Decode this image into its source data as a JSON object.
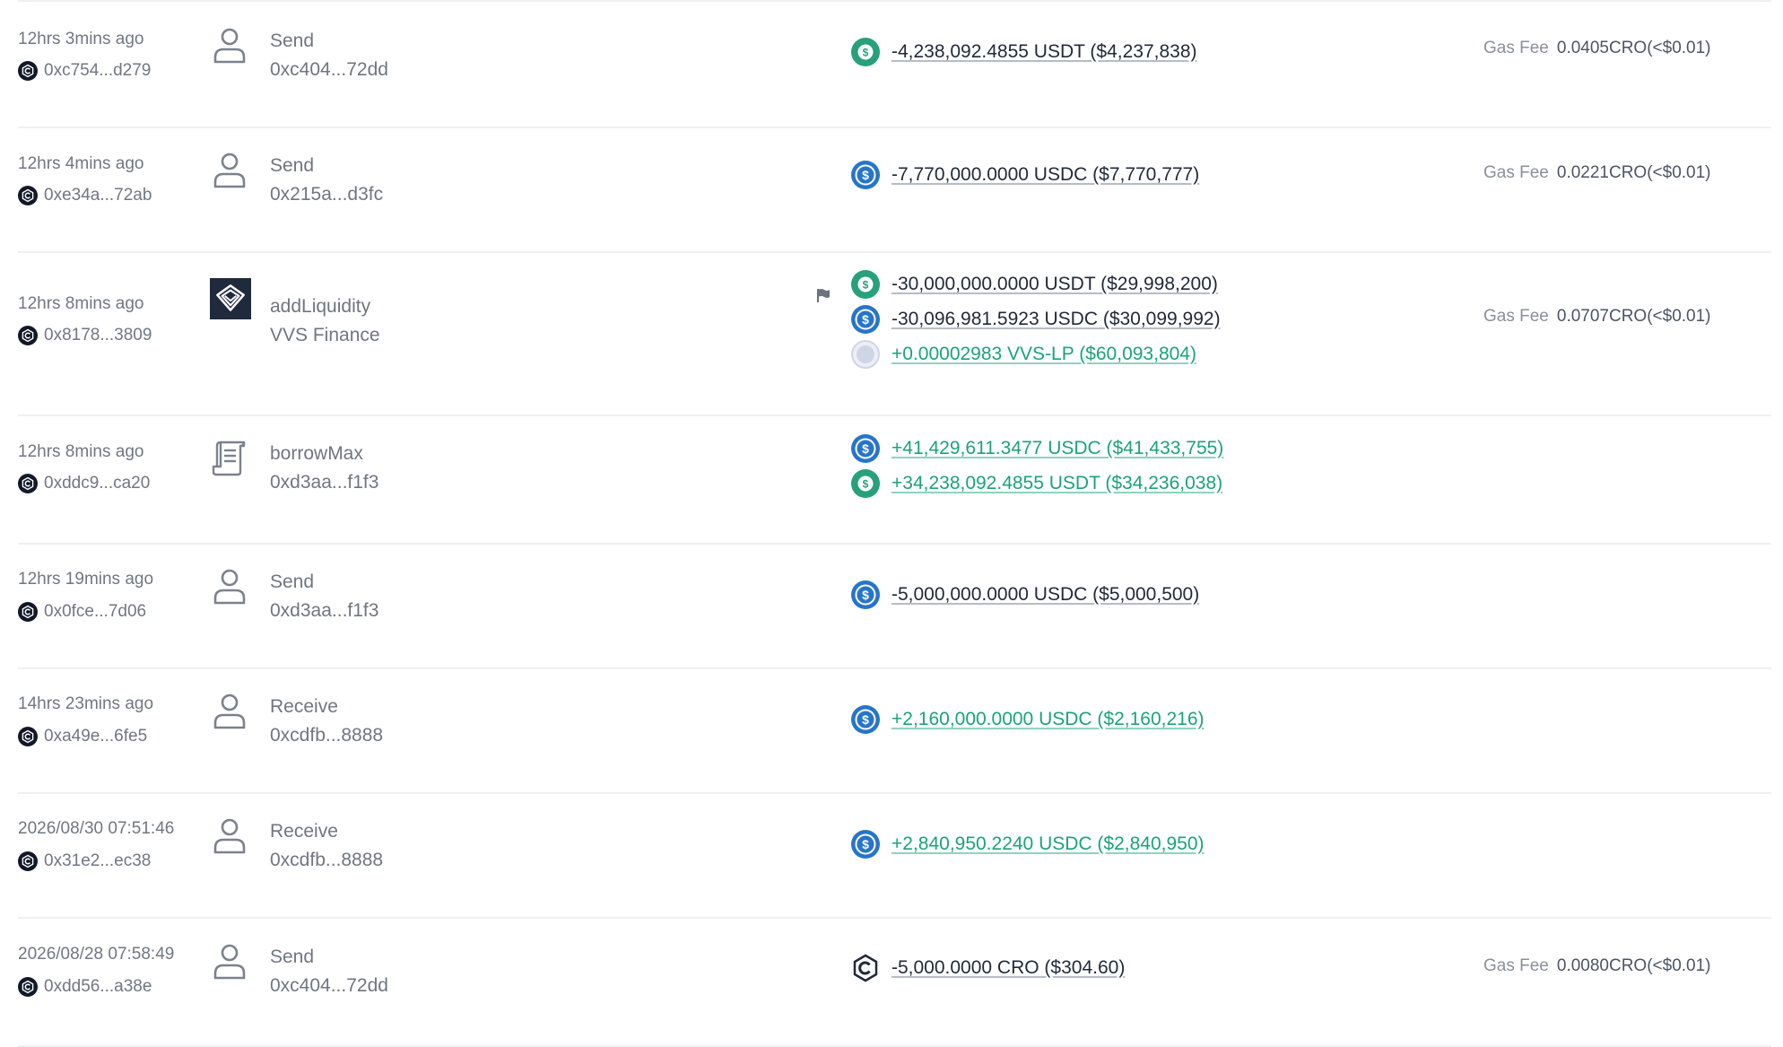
{
  "colors": {
    "usdt": "#26a17b",
    "usdc": "#2775ca",
    "lp": "#d0d5e6",
    "positive": "#1aa37a",
    "negative": "#1f2937",
    "divider": "#eef0f3"
  },
  "rows": [
    {
      "time": "12hrs 3mins ago",
      "hash": "0xc754...d279",
      "action": "Send",
      "address": "0xc404...72dd",
      "action_icon": "user-icon",
      "flag": false,
      "transfers": [
        {
          "icon": "usdt-icon",
          "text": "-4,238,092.4855 USDT ($4,237,838)",
          "sign": "neg"
        }
      ],
      "gas_label": "Gas Fee",
      "gas_value": "0.0405CRO(<$0.01)"
    },
    {
      "time": "12hrs 4mins ago",
      "hash": "0xe34a...72ab",
      "action": "Send",
      "address": "0x215a...d3fc",
      "action_icon": "user-icon",
      "flag": false,
      "transfers": [
        {
          "icon": "usdc-icon",
          "text": "-7,770,000.0000 USDC ($7,770,777)",
          "sign": "neg"
        }
      ],
      "gas_label": "Gas Fee",
      "gas_value": "0.0221CRO(<$0.01)"
    },
    {
      "time": "12hrs 8mins ago",
      "hash": "0x8178...3809",
      "action": "addLiquidity",
      "address": "VVS Finance",
      "action_icon": "vvs-finance-logo-icon",
      "flag": true,
      "transfers": [
        {
          "icon": "usdt-icon",
          "text": "-30,000,000.0000 USDT ($29,998,200)",
          "sign": "neg"
        },
        {
          "icon": "usdc-icon",
          "text": "-30,096,981.5923 USDC ($30,099,992)",
          "sign": "neg"
        },
        {
          "icon": "vvs-lp-icon",
          "text": "+0.00002983 VVS-LP ($60,093,804)",
          "sign": "pos"
        }
      ],
      "gas_label": "Gas Fee",
      "gas_value": "0.0707CRO(<$0.01)"
    },
    {
      "time": "12hrs 8mins ago",
      "hash": "0xddc9...ca20",
      "action": "borrowMax",
      "address": "0xd3aa...f1f3",
      "action_icon": "contract-scroll-icon",
      "flag": false,
      "transfers": [
        {
          "icon": "usdc-icon",
          "text": "+41,429,611.3477 USDC ($41,433,755)",
          "sign": "pos"
        },
        {
          "icon": "usdt-icon",
          "text": "+34,238,092.4855 USDT ($34,236,038)",
          "sign": "pos"
        }
      ],
      "gas_label": "",
      "gas_value": ""
    },
    {
      "time": "12hrs 19mins ago",
      "hash": "0x0fce...7d06",
      "action": "Send",
      "address": "0xd3aa...f1f3",
      "action_icon": "user-icon",
      "flag": false,
      "transfers": [
        {
          "icon": "usdc-icon",
          "text": "-5,000,000.0000 USDC ($5,000,500)",
          "sign": "neg"
        }
      ],
      "gas_label": "",
      "gas_value": ""
    },
    {
      "time": "14hrs 23mins ago",
      "hash": "0xa49e...6fe5",
      "action": "Receive",
      "address": "0xcdfb...8888",
      "action_icon": "user-icon",
      "flag": false,
      "transfers": [
        {
          "icon": "usdc-icon",
          "text": "+2,160,000.0000 USDC ($2,160,216)",
          "sign": "pos"
        }
      ],
      "gas_label": "",
      "gas_value": ""
    },
    {
      "time": "2026/08/30 07:51:46",
      "hash": "0x31e2...ec38",
      "action": "Receive",
      "address": "0xcdfb...8888",
      "action_icon": "user-icon",
      "flag": false,
      "transfers": [
        {
          "icon": "usdc-icon",
          "text": "+2,840,950.2240 USDC ($2,840,950)",
          "sign": "pos"
        }
      ],
      "gas_label": "",
      "gas_value": ""
    },
    {
      "time": "2026/08/28 07:58:49",
      "hash": "0xdd56...a38e",
      "action": "Send",
      "address": "0xc404...72dd",
      "action_icon": "user-icon",
      "flag": false,
      "transfers": [
        {
          "icon": "cro-icon",
          "text": "-5,000.0000 CRO ($304.60)",
          "sign": "neg"
        }
      ],
      "gas_label": "Gas Fee",
      "gas_value": "0.0080CRO(<$0.01)"
    }
  ]
}
